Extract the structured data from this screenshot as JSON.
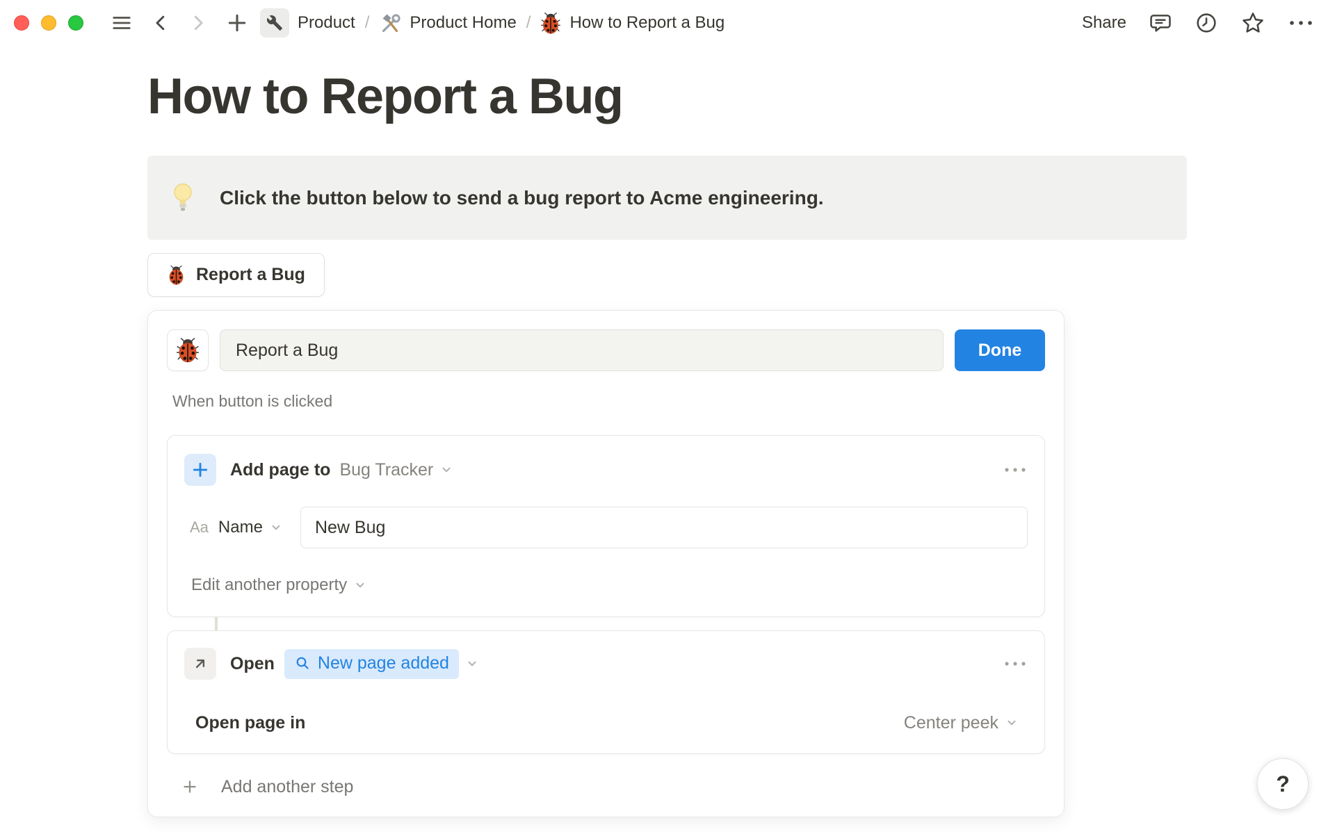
{
  "topbar": {
    "share_label": "Share",
    "separator": "/",
    "breadcrumb": [
      {
        "label": "Product"
      },
      {
        "label": "Product Home"
      },
      {
        "label": "How to Report a Bug"
      }
    ]
  },
  "page": {
    "title": "How to Report a Bug",
    "callout_text": "Click the button below to send a bug report to Acme engineering.",
    "button_label": "Report a Bug"
  },
  "editor": {
    "name_value": "Report a Bug",
    "done_label": "Done",
    "trigger_label": "When button is clicked",
    "steps": [
      {
        "action_label": "Add page to",
        "target": "Bug Tracker",
        "fields": [
          {
            "type_icon": "Aa",
            "name": "Name",
            "value": "New Bug"
          }
        ],
        "edit_another_label": "Edit another property"
      },
      {
        "action_label": "Open",
        "target": "New page added",
        "open_page_in_label": "Open page in",
        "open_mode": "Center peek"
      }
    ],
    "add_step_label": "Add another step"
  },
  "help_label": "?",
  "icons": {
    "product_space": "wrench-icon",
    "product_home": "hammer-wrench-icon",
    "bug_page": "ladybug-icon",
    "callout": "light-bulb-icon",
    "step_add_page": "plus-icon",
    "step_open": "arrow-up-right-icon",
    "target_search": "search-icon"
  },
  "colors": {
    "accent_blue": "#2383e2",
    "text_primary": "#37352f",
    "text_secondary": "#787774",
    "callout_bg": "#f1f1ef",
    "light_blue_bg": "#ddebfb",
    "pill_bg": "#d9eafc",
    "traffic_red": "#ff5f57",
    "traffic_yellow": "#febc2e",
    "traffic_green": "#28c840"
  }
}
